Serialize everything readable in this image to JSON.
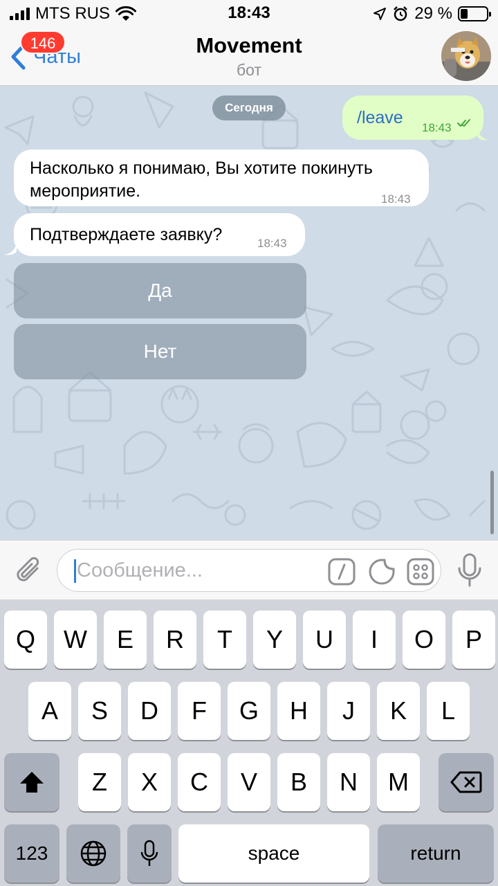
{
  "status_bar": {
    "carrier": "MTS RUS",
    "time": "18:43",
    "battery_pct": "29 %",
    "battery_level": 0.29
  },
  "nav": {
    "back_label": "Чаты",
    "unread_count": "146",
    "title": "Movement",
    "subtitle": "бот"
  },
  "chat": {
    "date_label": "Сегодня",
    "messages": [
      {
        "direction": "out",
        "text": "/leave",
        "time": "18:43",
        "status": "read"
      },
      {
        "direction": "in",
        "text_line1": "Насколько я понимаю, Вы хотите покинуть",
        "text_line2": "мероприятие.",
        "time": "18:43"
      },
      {
        "direction": "in",
        "text": "Подтверждаете заявку?",
        "time": "18:43"
      }
    ],
    "inline_buttons": [
      {
        "label": "Да"
      },
      {
        "label": "Нет"
      }
    ]
  },
  "input": {
    "placeholder": "Сообщение..."
  },
  "icons": {
    "attach": "paperclip-icon",
    "commands": "slash-command-icon",
    "stickers": "sticker-icon",
    "emoji": "emoji-grid-icon",
    "voice": "microphone-icon"
  },
  "keyboard": {
    "row1": [
      "Q",
      "W",
      "E",
      "R",
      "T",
      "Y",
      "U",
      "I",
      "O",
      "P"
    ],
    "row2": [
      "A",
      "S",
      "D",
      "F",
      "G",
      "H",
      "J",
      "K",
      "L"
    ],
    "row3": [
      "Z",
      "X",
      "C",
      "V",
      "B",
      "N",
      "M"
    ],
    "numbers_label": "123",
    "space_label": "space",
    "return_label": "return"
  },
  "colors": {
    "accent": "#2f7fd7",
    "outgoing_bubble": "#e1fec6",
    "chat_background": "#cfdbe6",
    "badge": "#ff3b30"
  }
}
